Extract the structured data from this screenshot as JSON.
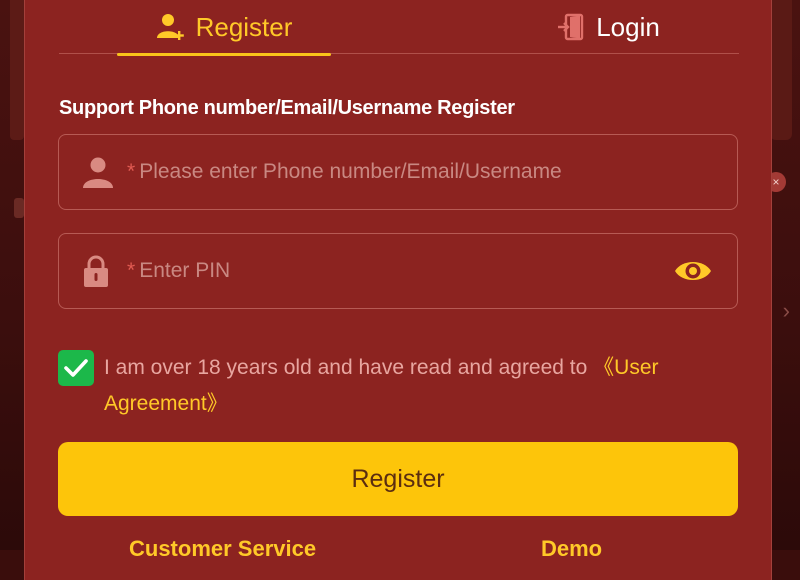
{
  "tabs": {
    "register_label": "Register",
    "login_label": "Login"
  },
  "form": {
    "subtitle": "Support Phone number/Email/Username Register",
    "account_placeholder": "Please enter Phone number/Email/Username",
    "pin_placeholder": "Enter PIN",
    "required_mark": "*",
    "agreement_checked": true,
    "agreement_text": "I am over 18 years old and have read and agreed to ",
    "agreement_link": "《User Agreement》",
    "submit_label": "Register"
  },
  "footer": {
    "customer_service": "Customer Service",
    "demo": "Demo"
  },
  "icons": {
    "register_tab": "user-plus-icon",
    "login_tab": "door-enter-icon",
    "account_field": "user-icon",
    "pin_field": "lock-icon",
    "pin_toggle": "eye-icon",
    "checkbox": "checkmark-icon"
  },
  "colors": {
    "panel": "#8c2320",
    "accent": "#ffc928",
    "button": "#fdc50a",
    "checkbox": "#1cb84a"
  }
}
